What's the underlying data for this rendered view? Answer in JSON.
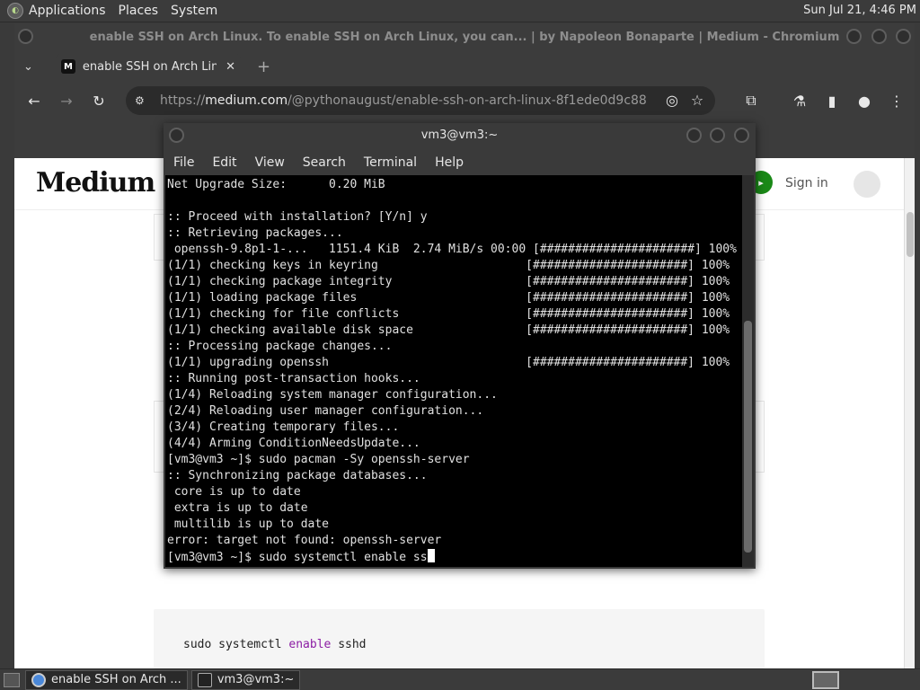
{
  "top_panel": {
    "menus": [
      "Applications",
      "Places",
      "System"
    ],
    "clock": "Sun Jul 21,  4:46 PM"
  },
  "browser": {
    "window_title": "enable SSH on Arch Linux. To enable SSH on Arch Linux, you can... | by Napoleon Bonaparte | Medium - Chromium",
    "tab": {
      "title": "enable SSH on Arch Linux. To",
      "favicon": "M"
    },
    "url": {
      "scheme": "https://",
      "host": "medium.com",
      "path": "/@pythonaugust/enable-ssh-on-arch-linux-8f1ede0d9c88"
    },
    "icons": {
      "back": "←",
      "forward": "→",
      "reload": "↻",
      "site_info": "⚙",
      "eye": "◎",
      "star": "☆",
      "extensions": "⧉",
      "labs": "⚗",
      "sidebar": "▮",
      "profile": "●",
      "menu": "⋮"
    }
  },
  "page": {
    "logo": "Medium",
    "sign_in": "Sign in",
    "code": {
      "cmd": "sudo systemctl ",
      "kw": "enable",
      "arg": " sshd"
    }
  },
  "terminal": {
    "title": "vm3@vm3:~",
    "menus": [
      "File",
      "Edit",
      "View",
      "Search",
      "Terminal",
      "Help"
    ],
    "lines": [
      "Net Upgrade Size:      0.20 MiB",
      "",
      ":: Proceed with installation? [Y/n] y",
      ":: Retrieving packages...",
      " openssh-9.8p1-1-...   1151.4 KiB  2.74 MiB/s 00:00 [######################] 100%",
      "(1/1) checking keys in keyring                     [######################] 100%",
      "(1/1) checking package integrity                   [######################] 100%",
      "(1/1) loading package files                        [######################] 100%",
      "(1/1) checking for file conflicts                  [######################] 100%",
      "(1/1) checking available disk space                [######################] 100%",
      ":: Processing package changes...",
      "(1/1) upgrading openssh                            [######################] 100%",
      ":: Running post-transaction hooks...",
      "(1/4) Reloading system manager configuration...",
      "(2/4) Reloading user manager configuration...",
      "(3/4) Creating temporary files...",
      "(4/4) Arming ConditionNeedsUpdate...",
      "[vm3@vm3 ~]$ sudo pacman -Sy openssh-server",
      ":: Synchronizing package databases...",
      " core is up to date",
      " extra is up to date",
      " multilib is up to date",
      "error: target not found: openssh-server"
    ],
    "prompt_line": "[vm3@vm3 ~]$ sudo systemctl enable ss"
  },
  "taskbar": {
    "tasks": [
      {
        "label": "enable SSH on Arch ...",
        "icon": "chromium-icon"
      },
      {
        "label": "vm3@vm3:~",
        "icon": "terminal-icon"
      }
    ]
  }
}
